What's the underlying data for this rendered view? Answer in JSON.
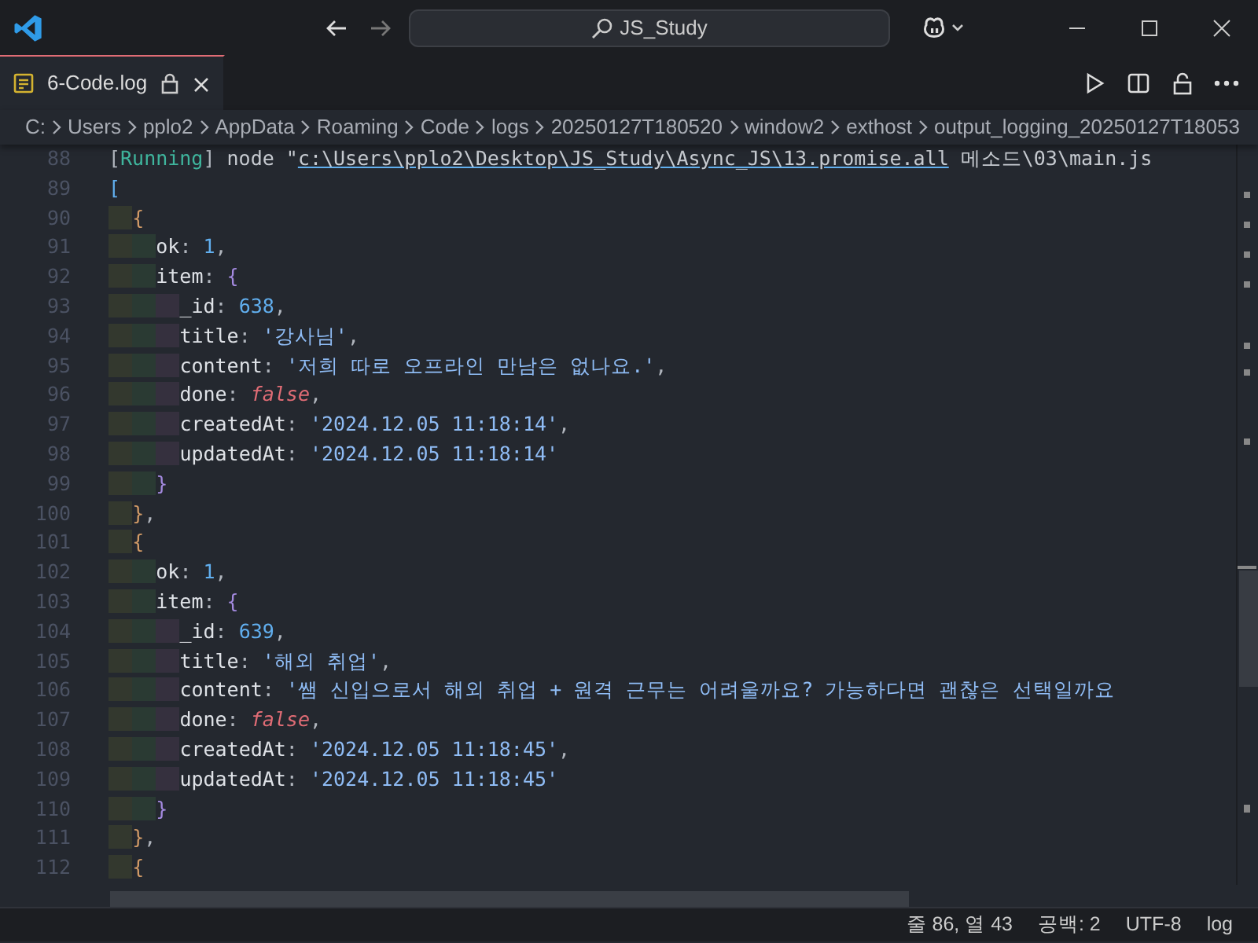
{
  "title_bar": {
    "search": "JS_Study"
  },
  "tabs": [
    {
      "label": "6-Code.log",
      "selected": true,
      "locked": true
    }
  ],
  "breadcrumbs": [
    "C:",
    "Users",
    "pplo2",
    "AppData",
    "Roaming",
    "Code",
    "logs",
    "20250127T180520",
    "window2",
    "exthost",
    "output_logging_20250127T18053"
  ],
  "editor": {
    "lines": [
      {
        "number": "88",
        "tokens": [
          {
            "kind": "punct",
            "text": "["
          },
          {
            "kind": "status",
            "text": "Running"
          },
          {
            "kind": "punct",
            "text": "]"
          },
          {
            "kind": "plain",
            "text": " node \""
          },
          {
            "kind": "link",
            "text": "c:\\Users\\pplo2\\Desktop\\JS_Study\\Async_JS\\13.promise.all"
          },
          {
            "kind": "plain",
            "text": " 메소드\\03\\main.js"
          }
        ]
      },
      {
        "number": "89",
        "tokens": [
          {
            "kind": "bracket_a",
            "text": "["
          }
        ]
      },
      {
        "number": "90",
        "tokens": [
          {
            "kind": "bracket_b",
            "text": "  {"
          }
        ]
      },
      {
        "number": "91",
        "tokens": [
          {
            "kind": "key",
            "text": "    ok"
          },
          {
            "kind": "punct",
            "text": ": "
          },
          {
            "kind": "number",
            "text": "1"
          },
          {
            "kind": "punct",
            "text": ","
          }
        ]
      },
      {
        "number": "92",
        "tokens": [
          {
            "kind": "key",
            "text": "    item"
          },
          {
            "kind": "punct",
            "text": ": "
          },
          {
            "kind": "bracket_c",
            "text": "{"
          }
        ]
      },
      {
        "number": "93",
        "tokens": [
          {
            "kind": "key",
            "text": "      _id"
          },
          {
            "kind": "punct",
            "text": ": "
          },
          {
            "kind": "number",
            "text": "638"
          },
          {
            "kind": "punct",
            "text": ","
          }
        ]
      },
      {
        "number": "94",
        "tokens": [
          {
            "kind": "key",
            "text": "      title"
          },
          {
            "kind": "punct",
            "text": ": "
          },
          {
            "kind": "string",
            "text": "'강사님'"
          },
          {
            "kind": "punct",
            "text": ","
          }
        ]
      },
      {
        "number": "95",
        "tokens": [
          {
            "kind": "key",
            "text": "      content"
          },
          {
            "kind": "punct",
            "text": ": "
          },
          {
            "kind": "string",
            "text": "'저희 따로 오프라인 만남은 없나요.'"
          },
          {
            "kind": "punct",
            "text": ","
          }
        ]
      },
      {
        "number": "96",
        "tokens": [
          {
            "kind": "key",
            "text": "      done"
          },
          {
            "kind": "punct",
            "text": ": "
          },
          {
            "kind": "boolean",
            "text": "false"
          },
          {
            "kind": "punct",
            "text": ","
          }
        ]
      },
      {
        "number": "97",
        "tokens": [
          {
            "kind": "key",
            "text": "      createdAt"
          },
          {
            "kind": "punct",
            "text": ": "
          },
          {
            "kind": "string",
            "text": "'2024.12.05 11:18:14'"
          },
          {
            "kind": "punct",
            "text": ","
          }
        ]
      },
      {
        "number": "98",
        "tokens": [
          {
            "kind": "key",
            "text": "      updatedAt"
          },
          {
            "kind": "punct",
            "text": ": "
          },
          {
            "kind": "string",
            "text": "'2024.12.05 11:18:14'"
          }
        ]
      },
      {
        "number": "99",
        "tokens": [
          {
            "kind": "bracket_c",
            "text": "    }"
          }
        ]
      },
      {
        "number": "100",
        "tokens": [
          {
            "kind": "bracket_b",
            "text": "  }"
          },
          {
            "kind": "punct",
            "text": ","
          }
        ]
      },
      {
        "number": "101",
        "tokens": [
          {
            "kind": "bracket_b",
            "text": "  {"
          }
        ]
      },
      {
        "number": "102",
        "tokens": [
          {
            "kind": "key",
            "text": "    ok"
          },
          {
            "kind": "punct",
            "text": ": "
          },
          {
            "kind": "number",
            "text": "1"
          },
          {
            "kind": "punct",
            "text": ","
          }
        ]
      },
      {
        "number": "103",
        "tokens": [
          {
            "kind": "key",
            "text": "    item"
          },
          {
            "kind": "punct",
            "text": ": "
          },
          {
            "kind": "bracket_c",
            "text": "{"
          }
        ]
      },
      {
        "number": "104",
        "tokens": [
          {
            "kind": "key",
            "text": "      _id"
          },
          {
            "kind": "punct",
            "text": ": "
          },
          {
            "kind": "number",
            "text": "639"
          },
          {
            "kind": "punct",
            "text": ","
          }
        ]
      },
      {
        "number": "105",
        "tokens": [
          {
            "kind": "key",
            "text": "      title"
          },
          {
            "kind": "punct",
            "text": ": "
          },
          {
            "kind": "string",
            "text": "'해외 취업'"
          },
          {
            "kind": "punct",
            "text": ","
          }
        ]
      },
      {
        "number": "106",
        "tokens": [
          {
            "kind": "key",
            "text": "      content"
          },
          {
            "kind": "punct",
            "text": ": "
          },
          {
            "kind": "string",
            "text": "'쌤 신입으로서 해외 취업 + 원격 근무는 어려울까요? 가능하다면 괜찮은 선택일까요"
          }
        ]
      },
      {
        "number": "107",
        "tokens": [
          {
            "kind": "key",
            "text": "      done"
          },
          {
            "kind": "punct",
            "text": ": "
          },
          {
            "kind": "boolean",
            "text": "false"
          },
          {
            "kind": "punct",
            "text": ","
          }
        ]
      },
      {
        "number": "108",
        "tokens": [
          {
            "kind": "key",
            "text": "      createdAt"
          },
          {
            "kind": "punct",
            "text": ": "
          },
          {
            "kind": "string",
            "text": "'2024.12.05 11:18:45'"
          },
          {
            "kind": "punct",
            "text": ","
          }
        ]
      },
      {
        "number": "109",
        "tokens": [
          {
            "kind": "key",
            "text": "      updatedAt"
          },
          {
            "kind": "punct",
            "text": ": "
          },
          {
            "kind": "string",
            "text": "'2024.12.05 11:18:45'"
          }
        ]
      },
      {
        "number": "110",
        "tokens": [
          {
            "kind": "bracket_c",
            "text": "    }"
          }
        ]
      },
      {
        "number": "111",
        "tokens": [
          {
            "kind": "bracket_b",
            "text": "  }"
          },
          {
            "kind": "punct",
            "text": ","
          }
        ]
      },
      {
        "number": "112",
        "tokens": [
          {
            "kind": "bracket_b",
            "text": "  {"
          }
        ]
      }
    ]
  },
  "status_bar": [
    "줄 86, 열 43",
    "공백: 2",
    "UTF-8",
    "log"
  ]
}
